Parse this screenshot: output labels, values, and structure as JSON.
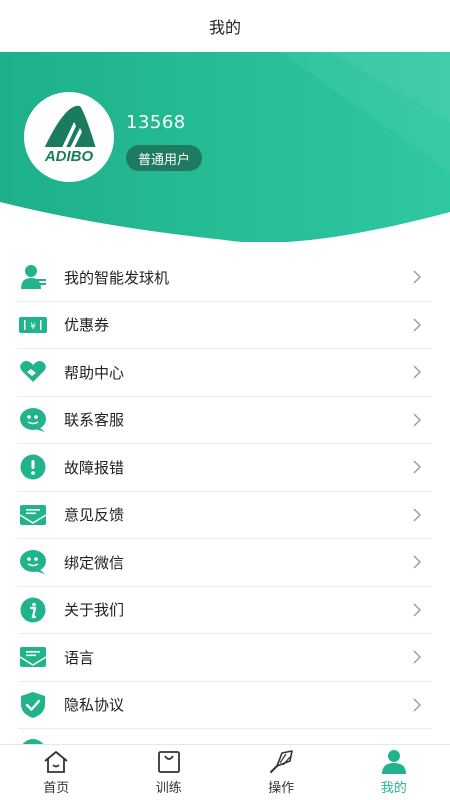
{
  "header": {
    "title": "我的"
  },
  "profile": {
    "phone": "13568",
    "role": "普通用户",
    "logo_text": "ADIBO"
  },
  "colors": {
    "accent": "#21b48c",
    "accent_dark": "#1f7a62",
    "hero_start": "#1db08a",
    "hero_end": "#2ec8a2"
  },
  "menu": [
    {
      "label": "我的智能发球机",
      "icon": "user-device-icon"
    },
    {
      "label": "优惠券",
      "icon": "coupon-icon"
    },
    {
      "label": "帮助中心",
      "icon": "handshake-icon"
    },
    {
      "label": "联系客服",
      "icon": "chat-icon"
    },
    {
      "label": "故障报错",
      "icon": "alert-icon"
    },
    {
      "label": "意见反馈",
      "icon": "mail-icon"
    },
    {
      "label": "绑定微信",
      "icon": "wechat-icon"
    },
    {
      "label": "关于我们",
      "icon": "info-icon"
    },
    {
      "label": "语言",
      "icon": "mail-icon"
    },
    {
      "label": "隐私协议",
      "icon": "shield-check-icon"
    }
  ],
  "tabs": [
    {
      "label": "首页",
      "icon": "home-icon",
      "active": false
    },
    {
      "label": "训练",
      "icon": "bag-icon",
      "active": false
    },
    {
      "label": "操作",
      "icon": "shuttlecock-icon",
      "active": false
    },
    {
      "label": "我的",
      "icon": "person-icon",
      "active": true
    }
  ]
}
